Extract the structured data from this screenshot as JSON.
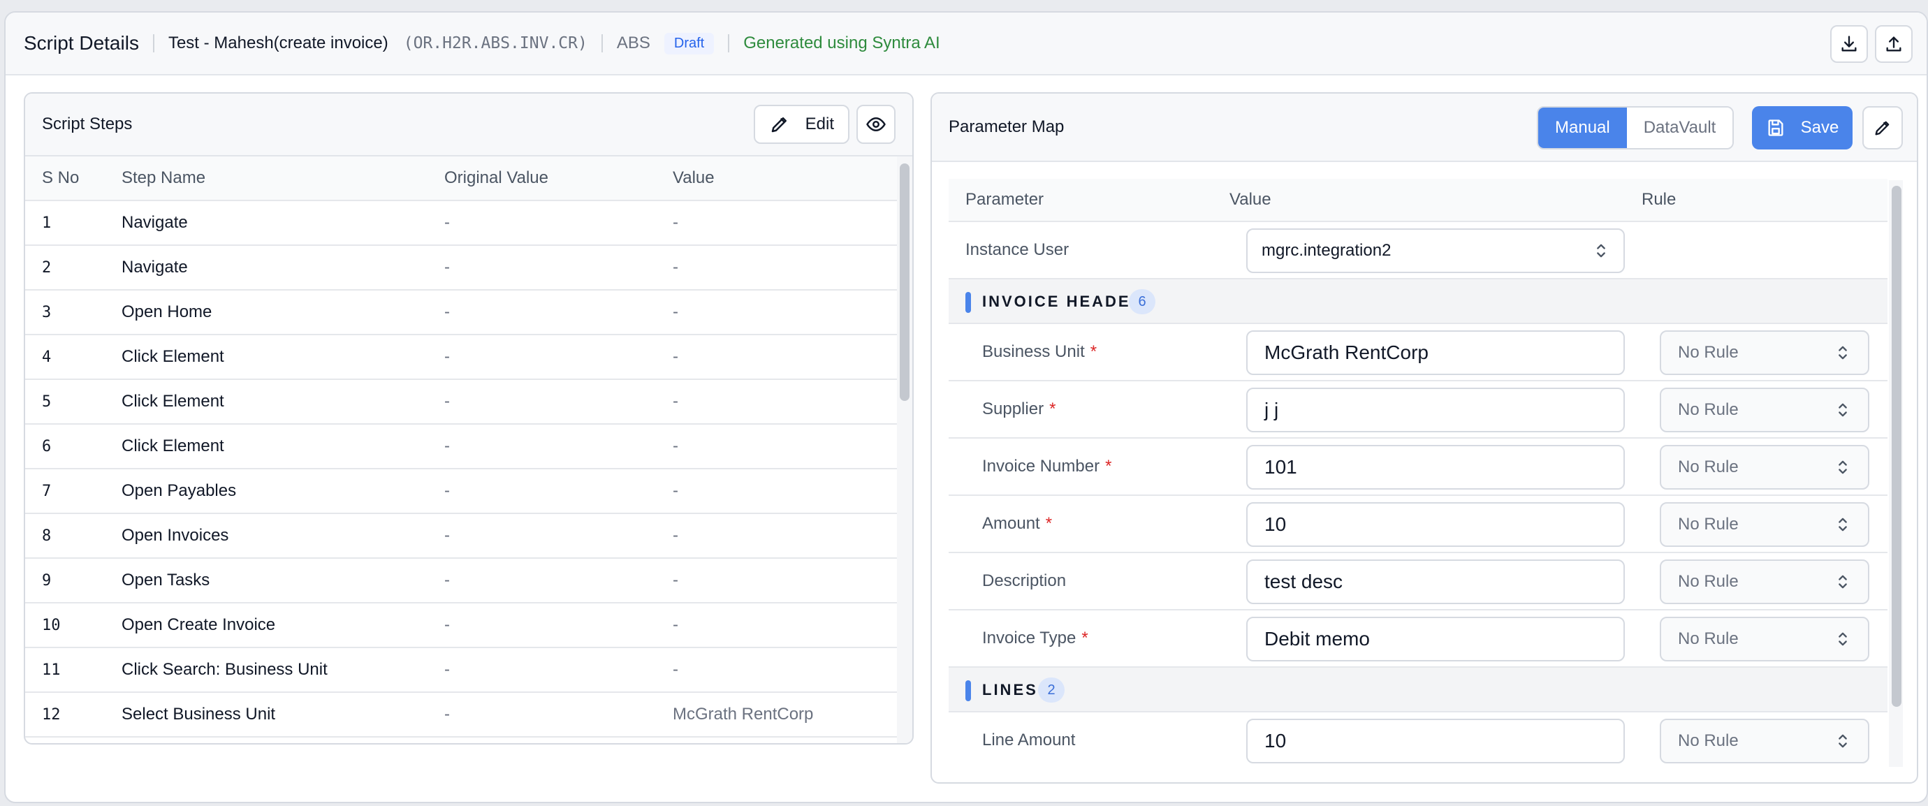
{
  "header": {
    "title": "Script Details",
    "script_name": "Test - Mahesh(create invoice)",
    "script_code": "(OR.H2R.ABS.INV.CR)",
    "module": "ABS",
    "status_badge": "Draft",
    "generated_note": "Generated using Syntra AI",
    "actions": [
      "download-icon",
      "upload-icon"
    ]
  },
  "script_steps": {
    "title": "Script Steps",
    "edit_label": "Edit",
    "columns": [
      "S No",
      "Step Name",
      "Original Value",
      "Value"
    ],
    "rows": [
      {
        "sno": "1",
        "name": "Navigate",
        "original": "-",
        "value": "-"
      },
      {
        "sno": "2",
        "name": "Navigate",
        "original": "-",
        "value": "-"
      },
      {
        "sno": "3",
        "name": "Open Home",
        "original": "-",
        "value": "-"
      },
      {
        "sno": "4",
        "name": "Click Element",
        "original": "-",
        "value": "-"
      },
      {
        "sno": "5",
        "name": "Click Element",
        "original": "-",
        "value": "-"
      },
      {
        "sno": "6",
        "name": "Click Element",
        "original": "-",
        "value": "-"
      },
      {
        "sno": "7",
        "name": "Open Payables",
        "original": "-",
        "value": "-"
      },
      {
        "sno": "8",
        "name": "Open Invoices",
        "original": "-",
        "value": "-"
      },
      {
        "sno": "9",
        "name": "Open Tasks",
        "original": "-",
        "value": "-"
      },
      {
        "sno": "10",
        "name": "Open Create Invoice",
        "original": "-",
        "value": "-"
      },
      {
        "sno": "11",
        "name": "Click Search: Business Unit",
        "original": "-",
        "value": "-"
      },
      {
        "sno": "12",
        "name": "Select Business Unit",
        "original": "-",
        "value": "McGrath RentCorp"
      }
    ]
  },
  "parameter_map": {
    "title": "Parameter Map",
    "toggle_manual": "Manual",
    "toggle_datavault": "DataVault",
    "active_toggle": "Manual",
    "save_label": "Save",
    "columns": [
      "Parameter",
      "Value",
      "Rule"
    ],
    "instance_user": {
      "label": "Instance User",
      "value": "mgrc.integration2"
    },
    "groups": [
      {
        "name": "INVOICE HEADER",
        "count": "6",
        "params": [
          {
            "label": "Business Unit",
            "required": "*",
            "value": "McGrath RentCorp",
            "rule": "No Rule"
          },
          {
            "label": "Supplier",
            "required": "*",
            "value": "j j",
            "rule": "No Rule"
          },
          {
            "label": "Invoice Number",
            "required": "*",
            "value": "101",
            "rule": "No Rule"
          },
          {
            "label": "Amount",
            "required": "*",
            "value": "10",
            "rule": "No Rule"
          },
          {
            "label": "Description",
            "required": "",
            "value": "test desc",
            "rule": "No Rule"
          },
          {
            "label": "Invoice Type",
            "required": "*",
            "value": "Debit memo",
            "rule": "No Rule"
          }
        ]
      },
      {
        "name": "LINES",
        "count": "2",
        "params": [
          {
            "label": "Line Amount",
            "required": "",
            "value": "10",
            "rule": "No Rule"
          }
        ]
      }
    ]
  },
  "colors": {
    "accent": "#4a84ea",
    "generated_text": "#2e8b3d",
    "required_marker": "#dc2626",
    "badge_text": "#2563eb"
  }
}
